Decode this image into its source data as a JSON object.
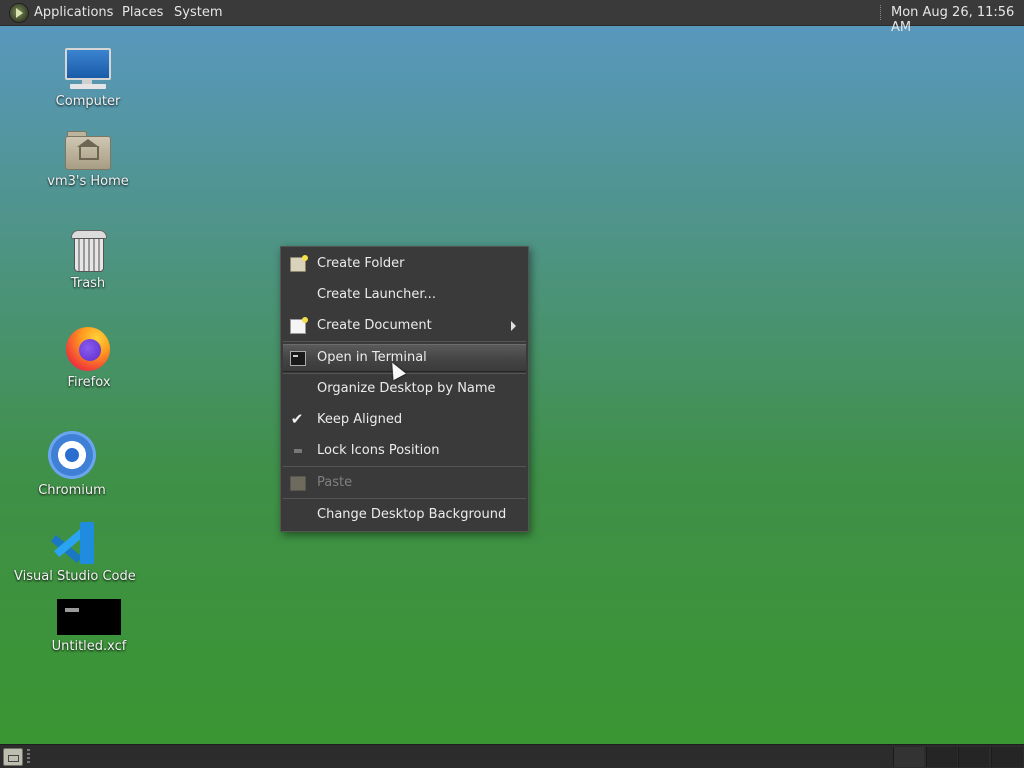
{
  "top_panel": {
    "menus": [
      "Applications",
      "Places",
      "System"
    ],
    "clock": "Mon Aug 26, 11:56 AM",
    "logo_icon": "mate-logo-icon"
  },
  "desktop_icons": [
    {
      "label": "Computer",
      "icon": "computer-icon"
    },
    {
      "label": "vm3's Home",
      "icon": "home-folder-icon"
    },
    {
      "label": "Trash",
      "icon": "trash-icon"
    },
    {
      "label": "Firefox",
      "icon": "firefox-icon"
    },
    {
      "label": "Chromium",
      "icon": "chromium-icon"
    },
    {
      "label": "Visual Studio Code",
      "icon": "vscode-icon"
    },
    {
      "label": "Untitled.xcf",
      "icon": "xcf-thumbnail-icon"
    }
  ],
  "context_menu": {
    "items": [
      {
        "label": "Create Folder",
        "icon": "create-folder-icon",
        "enabled": true
      },
      {
        "label": "Create Launcher...",
        "icon": "",
        "enabled": true
      },
      {
        "label": "Create Document",
        "icon": "create-document-icon",
        "enabled": true,
        "submenu": true
      },
      {
        "label": "Open in Terminal",
        "icon": "terminal-icon",
        "enabled": true,
        "highlighted": true
      },
      {
        "label": "Organize Desktop by Name",
        "icon": "",
        "enabled": true
      },
      {
        "label": "Keep Aligned",
        "icon": "checkmark-icon",
        "enabled": true,
        "checked": true
      },
      {
        "label": "Lock Icons Position",
        "icon": "lock-icon",
        "enabled": true
      },
      {
        "label": "Paste",
        "icon": "paste-icon",
        "enabled": false
      },
      {
        "label": "Change Desktop Background",
        "icon": "",
        "enabled": true
      }
    ]
  },
  "bottom_panel": {
    "show_desktop_icon": "show-desktop-icon",
    "workspaces": 4
  },
  "colors": {
    "panel_bg": "#3a3a3a",
    "menu_bg": "#3a3a3a",
    "desktop_top": "#5a98c4",
    "desktop_bottom": "#3a9630"
  }
}
